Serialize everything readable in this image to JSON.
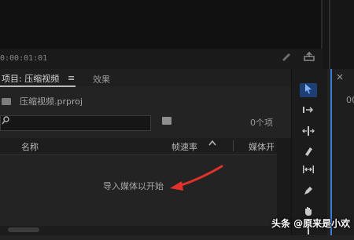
{
  "monitor": {
    "timecode": "0:00:01:01"
  },
  "project_panel": {
    "tab_label": "项目: 压缩视频",
    "tab_menu_glyph": "≡",
    "effects_tab_label": "效果",
    "file_name": "压缩视频.prproj",
    "search": {
      "value": "",
      "placeholder": ""
    },
    "item_count": "0个项",
    "columns": {
      "name": "名称",
      "frame_rate": "帧速率",
      "media": "媒体开"
    },
    "empty_message": "导入媒体以开始"
  },
  "right_panel": {
    "tab_label": "00"
  },
  "watermark": "头条 @原来是小欢",
  "colors": {
    "accent": "#3a7bd5",
    "annotation_arrow": "#e0322a",
    "background": "#232323"
  },
  "icons": {
    "search": "magnifier-icon",
    "new_bin": "folder-icon",
    "tools": [
      "selection-tool-icon",
      "track-select-tool-icon",
      "ripple-edit-tool-icon",
      "razor-tool-icon",
      "slip-tool-icon",
      "pen-tool-icon",
      "hand-tool-icon",
      "type-tool-icon"
    ]
  }
}
